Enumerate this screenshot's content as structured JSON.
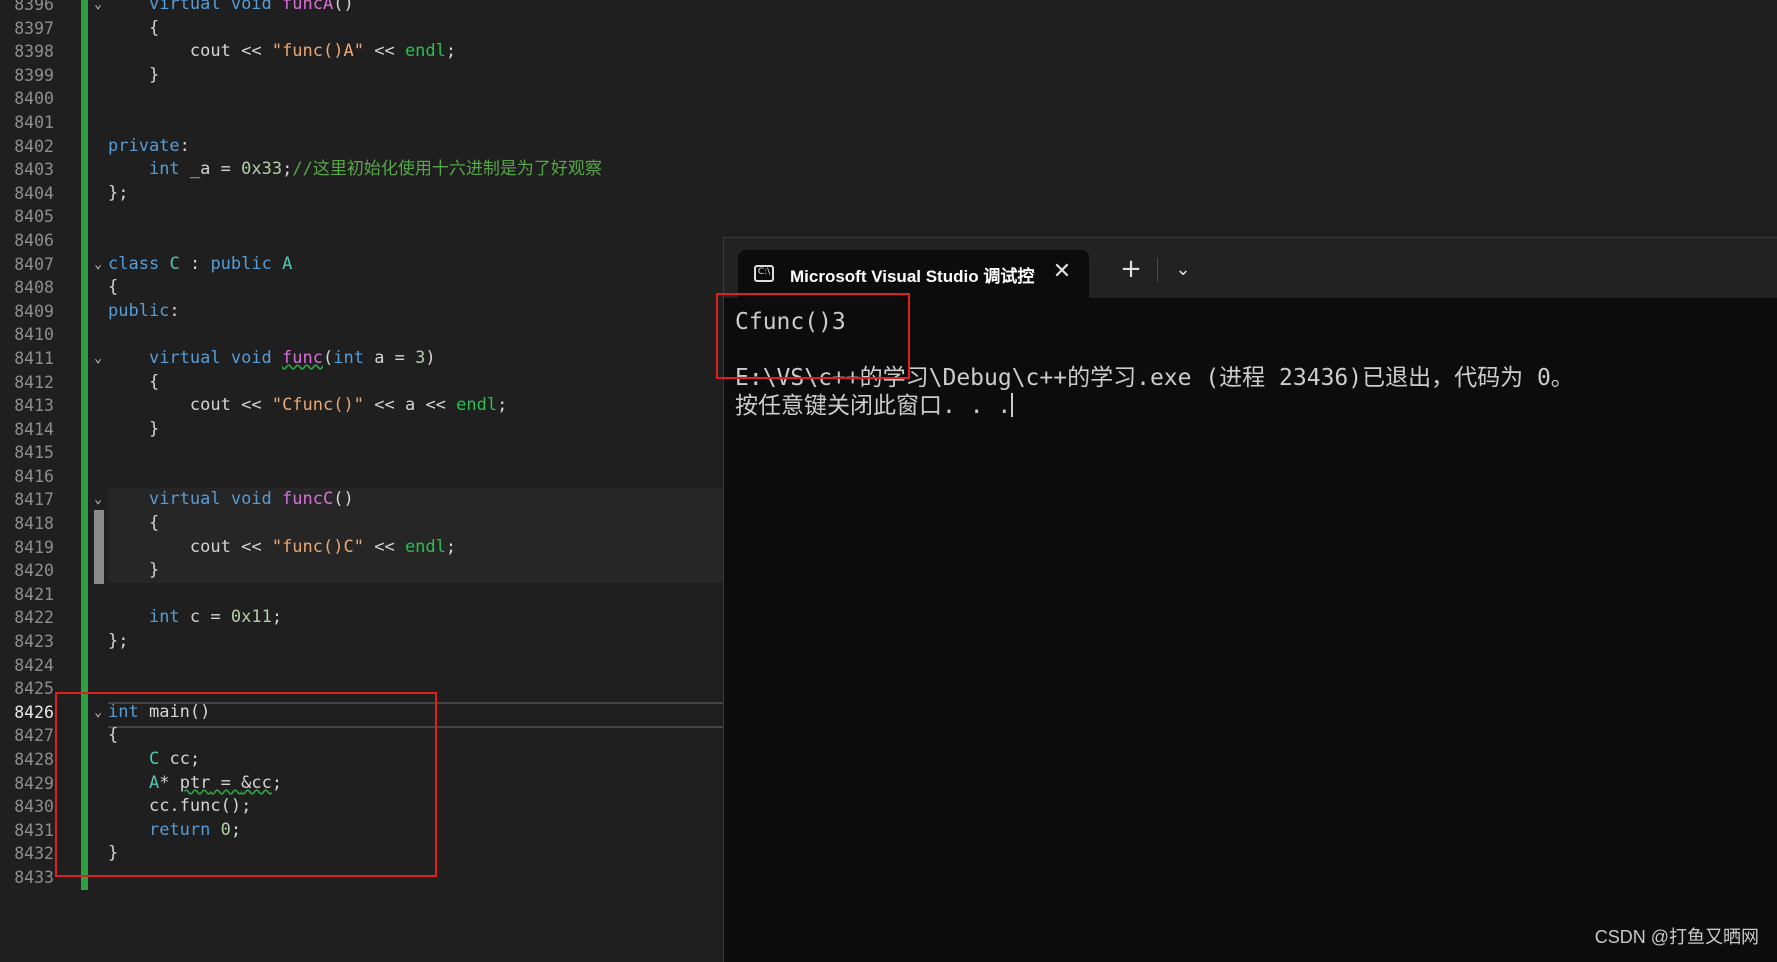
{
  "editor": {
    "line_numbers": [
      "8396",
      "8397",
      "8398",
      "8399",
      "8400",
      "8401",
      "8402",
      "8403",
      "8404",
      "8405",
      "8406",
      "8407",
      "8408",
      "8409",
      "8410",
      "8411",
      "8412",
      "8413",
      "8414",
      "8415",
      "8416",
      "8417",
      "8418",
      "8419",
      "8420",
      "8421",
      "8422",
      "8423",
      "8424",
      "8425",
      "8426",
      "8427",
      "8428",
      "8429",
      "8430",
      "8431",
      "8432",
      "8433"
    ],
    "current_line": "8426",
    "code": {
      "l8396_kw": "virtual void",
      "l8396_fn": "funcA",
      "cout": "cout",
      "endl": "endl",
      "str_funcA": "\"func()A\"",
      "private": "private",
      "int": "int",
      "var_a": "_a",
      "hex_a": "0x33",
      "comment": "//这里初始化使用十六进制是为了好观察",
      "class_kw": "class",
      "class_name": "C",
      "public_kw": "public",
      "base_name": "A",
      "public": "public",
      "virtual_void": "virtual void",
      "func": "func",
      "param": "int a = 3",
      "str_cfunc": "\"Cfunc()\"",
      "var_plain_a": "a",
      "funcC": "funcC",
      "str_funcC": "\"func()C\"",
      "var_c": "c",
      "hex_c": "0x11",
      "main": "main",
      "type_C": "C",
      "var_cc": "cc",
      "type_A": "A",
      "ptr": "ptr",
      "addr_cc": "&cc",
      "call": "cc.func();",
      "return_kw": "return",
      "zero": "0"
    }
  },
  "terminal": {
    "tab_title": "Microsoft Visual Studio 调试控制台",
    "icon": "console-icon",
    "close_glyph": "✕",
    "new_tab_glyph": "+",
    "dropdown_glyph": "⌄",
    "output_lines": [
      "Cfunc()3",
      "",
      "E:\\VS\\c++的学习\\Debug\\c++的学习.exe (进程 23436)已退出，代码为 0。",
      "按任意键关闭此窗口. . ."
    ]
  },
  "annotation_color": "#e02020",
  "watermark": "CSDN @打鱼又晒网"
}
